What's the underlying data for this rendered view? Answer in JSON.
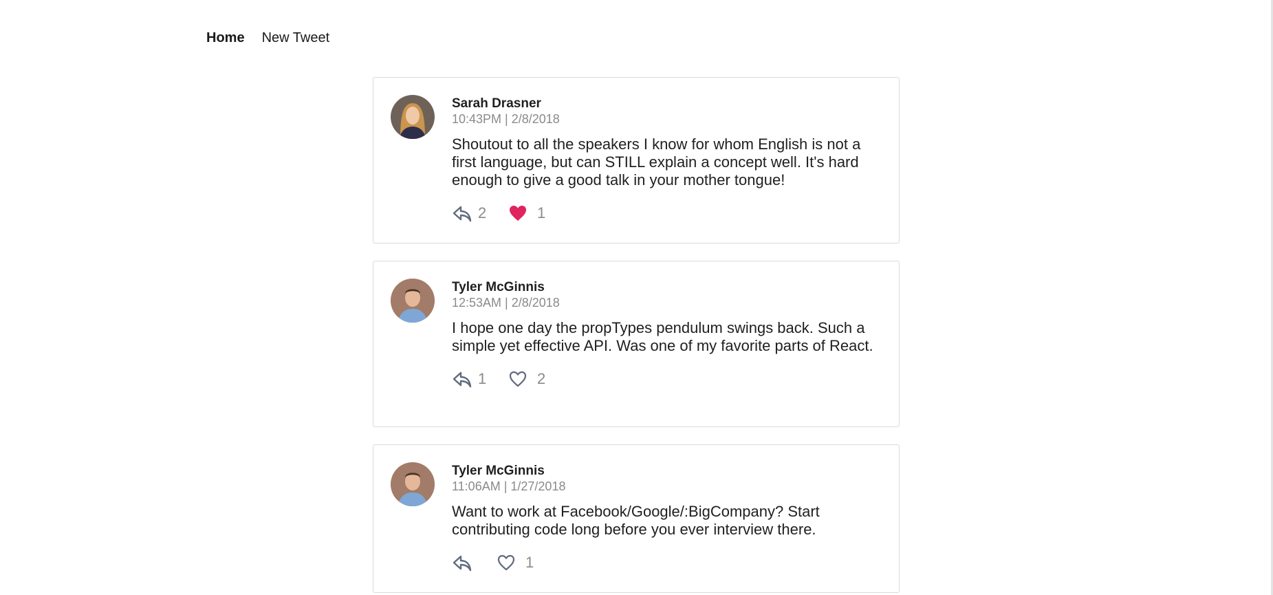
{
  "nav": {
    "home": "Home",
    "new_tweet": "New Tweet"
  },
  "colors": {
    "liked": "#e0245e",
    "icon": "#5f6b7d",
    "muted": "#8a8a8a",
    "border": "#dadada"
  },
  "tweets": [
    {
      "author": "Sarah Drasner",
      "timestamp": "10:43PM | 2/8/2018",
      "text": "Shoutout to all the speakers I know for whom English is not a first language, but can STILL explain a concept well. It's hard enough to give a good talk in your mother tongue!",
      "replies": "2",
      "likes": "1",
      "liked": true,
      "reply_icon": "reply-icon",
      "like_icon": "heart-filled-icon"
    },
    {
      "author": "Tyler McGinnis",
      "timestamp": "12:53AM | 2/8/2018",
      "text": "I hope one day the propTypes pendulum swings back. Such a simple yet effective API. Was one of my favorite parts of React.",
      "replies": "1",
      "likes": "2",
      "liked": false,
      "reply_icon": "reply-icon",
      "like_icon": "heart-outline-icon"
    },
    {
      "author": "Tyler McGinnis",
      "timestamp": "11:06AM | 1/27/2018",
      "text": "Want to work at Facebook/Google/:BigCompany? Start contributing code long before you ever interview there.",
      "replies": "",
      "likes": "1",
      "liked": false,
      "reply_icon": "reply-icon",
      "like_icon": "heart-outline-icon"
    }
  ]
}
